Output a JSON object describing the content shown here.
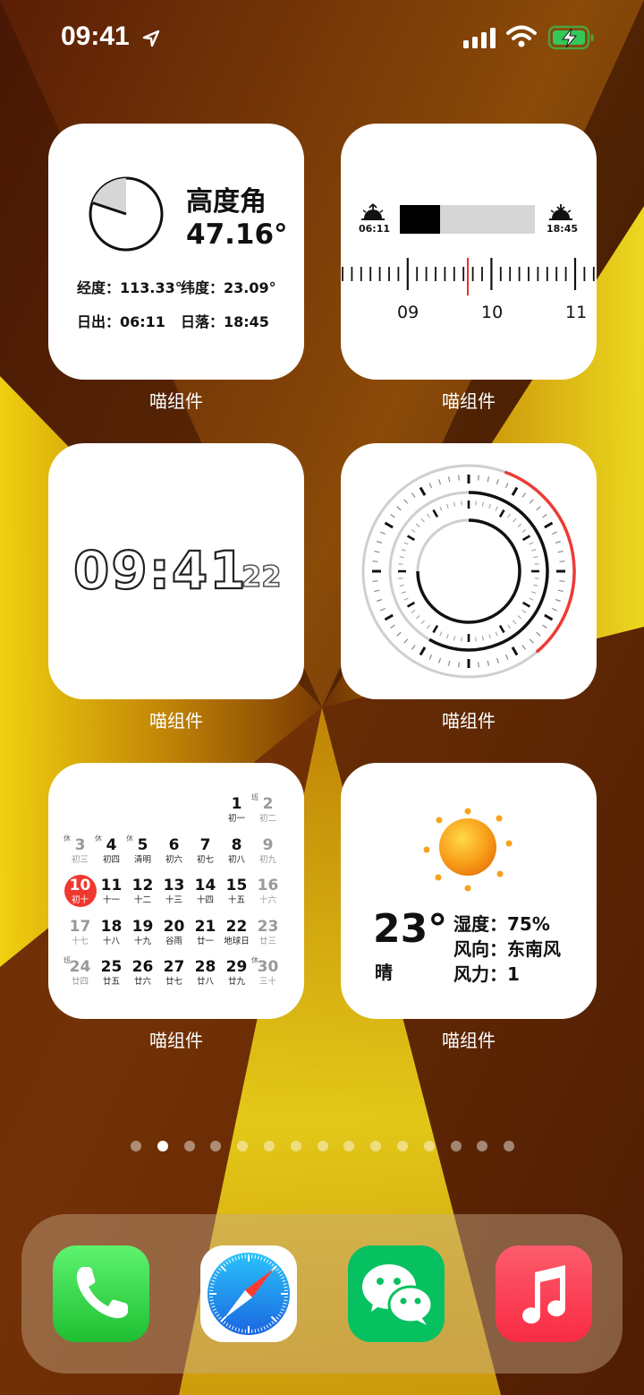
{
  "status": {
    "time": "09:41",
    "location_icon": "location-arrow-icon",
    "signal_icon": "cellular-signal-icon",
    "wifi_icon": "wifi-icon",
    "battery_icon": "battery-charging-icon",
    "battery_color": "#34c759"
  },
  "widgets": {
    "sun_angle": {
      "label": "喵组件",
      "title": "高度角",
      "value": "47.16°",
      "longitude": "经度：113.33°",
      "latitude": "纬度：23.09°",
      "sunrise": "日出：06:11",
      "sunset": "日落：18:45"
    },
    "sun_timeline": {
      "label": "喵组件",
      "sunrise_time": "06:11",
      "sunset_time": "18:45",
      "progress": 0.3,
      "ticks": [
        "09",
        "10",
        "11"
      ]
    },
    "digital_clock": {
      "label": "喵组件",
      "time": "09:41",
      "seconds": "22"
    },
    "analog_rings": {
      "label": "喵组件",
      "accent_color": "#ee3b36"
    },
    "calendar": {
      "label": "喵组件",
      "rows": [
        [
          {
            "d": "",
            "l": ""
          },
          {
            "d": "",
            "l": ""
          },
          {
            "d": "",
            "l": ""
          },
          {
            "d": "",
            "l": ""
          },
          {
            "d": "",
            "l": ""
          },
          {
            "d": "1",
            "l": "初一"
          },
          {
            "d": "2",
            "l": "初二",
            "tag": "班",
            "weekend": true
          }
        ],
        [
          {
            "d": "3",
            "l": "初三",
            "tag": "休",
            "weekend": true
          },
          {
            "d": "4",
            "l": "初四",
            "tag": "休"
          },
          {
            "d": "5",
            "l": "清明",
            "tag": "休"
          },
          {
            "d": "6",
            "l": "初六"
          },
          {
            "d": "7",
            "l": "初七"
          },
          {
            "d": "8",
            "l": "初八"
          },
          {
            "d": "9",
            "l": "初九",
            "weekend": true
          }
        ],
        [
          {
            "d": "10",
            "l": "初十",
            "today": true
          },
          {
            "d": "11",
            "l": "十一"
          },
          {
            "d": "12",
            "l": "十二"
          },
          {
            "d": "13",
            "l": "十三"
          },
          {
            "d": "14",
            "l": "十四"
          },
          {
            "d": "15",
            "l": "十五"
          },
          {
            "d": "16",
            "l": "十六",
            "weekend": true
          }
        ],
        [
          {
            "d": "17",
            "l": "十七",
            "weekend": true
          },
          {
            "d": "18",
            "l": "十八"
          },
          {
            "d": "19",
            "l": "十九"
          },
          {
            "d": "20",
            "l": "谷雨"
          },
          {
            "d": "21",
            "l": "廿一"
          },
          {
            "d": "22",
            "l": "地球日"
          },
          {
            "d": "23",
            "l": "廿三",
            "weekend": true
          }
        ],
        [
          {
            "d": "24",
            "l": "廿四",
            "tag": "班",
            "weekend": true
          },
          {
            "d": "25",
            "l": "廿五"
          },
          {
            "d": "26",
            "l": "廿六"
          },
          {
            "d": "27",
            "l": "廿七"
          },
          {
            "d": "28",
            "l": "廿八"
          },
          {
            "d": "29",
            "l": "廿九"
          },
          {
            "d": "30",
            "l": "三十",
            "tag": "休",
            "weekend": true
          }
        ]
      ],
      "today_color": "#f0382f"
    },
    "weather": {
      "label": "喵组件",
      "temperature": "23°",
      "condition": "晴",
      "humidity": "湿度：75%",
      "wind_dir": "风向：东南风",
      "wind_power": "风力：1",
      "icon": "sun-icon"
    }
  },
  "page_dots": {
    "count": 15,
    "active": 1
  },
  "dock": {
    "apps": [
      {
        "name": "phone",
        "icon": "phone-icon",
        "color": "#34c759"
      },
      {
        "name": "safari",
        "icon": "compass-icon",
        "color": "#1e88e5"
      },
      {
        "name": "wechat",
        "icon": "wechat-icon",
        "color": "#07c160"
      },
      {
        "name": "music",
        "icon": "music-note-icon",
        "color": "#fc3c44"
      }
    ]
  }
}
